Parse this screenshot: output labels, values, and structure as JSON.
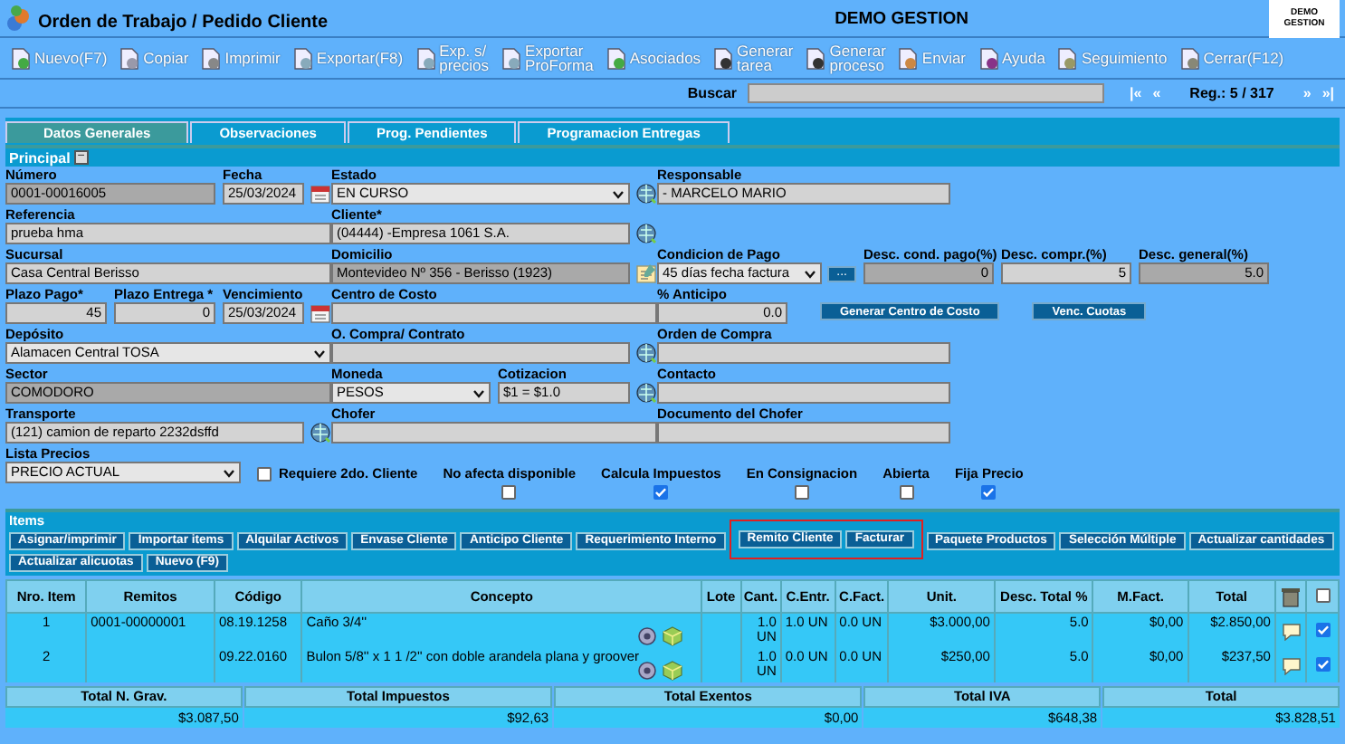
{
  "header": {
    "title": "Orden de Trabajo / Pedido Cliente",
    "company": "DEMO GESTION",
    "logo_text": "DEMO GESTION"
  },
  "toolbar": [
    {
      "label": "Nuevo(F7)"
    },
    {
      "label": "Copiar"
    },
    {
      "label": "Imprimir"
    },
    {
      "label": "Exportar(F8)"
    },
    {
      "label": "Exp. s/\nprecios"
    },
    {
      "label": "Exportar\nProForma"
    },
    {
      "label": "Asociados"
    },
    {
      "label": "Generar\ntarea"
    },
    {
      "label": "Generar\nproceso"
    },
    {
      "label": "Enviar"
    },
    {
      "label": "Ayuda"
    },
    {
      "label": "Seguimiento"
    },
    {
      "label": "Cerrar(F12)"
    }
  ],
  "navigation": {
    "search_label": "Buscar",
    "first": "|«",
    "previous": "«",
    "record": "Reg.: 5 / 317",
    "next": "»",
    "last": "»|"
  },
  "tabs": [
    {
      "label": "Datos Generales",
      "selected": true
    },
    {
      "label": "Observaciones",
      "selected": false
    },
    {
      "label": "Prog. Pendientes",
      "selected": false
    },
    {
      "label": "Programacion Entregas",
      "selected": false
    }
  ],
  "section": {
    "title": "Principal",
    "collapse": "−"
  },
  "form_rows": [
    [
      [
        {
          "label": "Número",
          "value": "0001-00016005",
          "kind": "text",
          "readonly": true,
          "lookup": false,
          "notes": false
        },
        {
          "label": "Fecha",
          "value": "25/03/2024",
          "kind": "date",
          "readonly": false,
          "lookup": false,
          "notes": false
        }
      ],
      [
        {
          "label": "Estado",
          "value": "EN CURSO",
          "kind": "select",
          "readonly": false,
          "lookup": true,
          "notes": false
        }
      ],
      [
        {
          "label": "Responsable",
          "value": "- MARCELO MARIO",
          "kind": "text",
          "readonly": false,
          "lookup": false,
          "notes": false
        }
      ]
    ],
    [
      [
        {
          "label": "Referencia",
          "value": "prueba hma",
          "kind": "text",
          "readonly": false,
          "lookup": false,
          "notes": false
        }
      ],
      [
        {
          "label": "Cliente*",
          "value": "(04444) -Empresa 1061 S.A.",
          "kind": "text",
          "readonly": false,
          "lookup": true,
          "notes": false
        }
      ],
      []
    ],
    [
      [
        {
          "label": "Sucursal",
          "value": "Casa Central Berisso",
          "kind": "text",
          "readonly": false,
          "lookup": false,
          "notes": false
        }
      ],
      [
        {
          "label": "Domicilio",
          "value": "Montevideo Nº 356 - Berisso (1923)",
          "kind": "text",
          "readonly": true,
          "lookup": false,
          "notes": true
        }
      ],
      [
        {
          "label": "Condicion de Pago",
          "value": "45 días fecha factura",
          "kind": "select",
          "readonly": false,
          "lookup": false,
          "notes": false,
          "addon_label": "..."
        },
        {
          "label": "Desc. cond. pago(%)",
          "value": "0",
          "kind": "number",
          "readonly": true,
          "lookup": false,
          "notes": false
        },
        {
          "label": "Desc. compr.(%)",
          "value": "5",
          "kind": "number",
          "readonly": false,
          "lookup": false,
          "notes": false
        },
        {
          "label": "Desc. general(%)",
          "value": "5.0",
          "kind": "number",
          "readonly": true,
          "lookup": false,
          "notes": false
        }
      ]
    ],
    [
      [
        {
          "label": "Plazo Pago*",
          "value": "45",
          "kind": "number",
          "readonly": false,
          "lookup": false,
          "notes": false
        },
        {
          "label": "Plazo Entrega *",
          "value": "0",
          "kind": "number",
          "readonly": false,
          "lookup": false,
          "notes": false
        },
        {
          "label": "Vencimiento",
          "value": "25/03/2024",
          "kind": "date",
          "readonly": false,
          "lookup": false,
          "notes": false
        }
      ],
      [
        {
          "label": "Centro de Costo",
          "kind": "text",
          "readonly": false,
          "lookup": false,
          "notes": false
        }
      ],
      [
        {
          "label": "% Anticipo",
          "value": "0.0",
          "kind": "number",
          "readonly": false,
          "lookup": false,
          "notes": false
        },
        {
          "value": "Generar Centro de Costo",
          "kind": "button"
        },
        {
          "value": "Venc. Cuotas",
          "kind": "button"
        }
      ]
    ],
    [
      [
        {
          "label": "Depósito",
          "value": "Alamacen Central TOSA",
          "kind": "select",
          "readonly": false,
          "lookup": false,
          "notes": false
        }
      ],
      [
        {
          "label": "O. Compra/ Contrato",
          "kind": "text",
          "readonly": false,
          "lookup": true,
          "notes": false
        }
      ],
      [
        {
          "label": "Orden de Compra",
          "kind": "text",
          "readonly": false,
          "lookup": false,
          "notes": false
        }
      ]
    ],
    [
      [
        {
          "label": "Sector",
          "value": "COMODORO",
          "kind": "text",
          "readonly": true,
          "lookup": false,
          "notes": false
        }
      ],
      [
        {
          "label": "Moneda",
          "value": "PESOS",
          "kind": "select",
          "readonly": false,
          "lookup": false,
          "notes": false
        },
        {
          "label": "Cotizacion",
          "value": "$1 = $1.0",
          "kind": "text",
          "readonly": false,
          "lookup": true,
          "notes": false
        }
      ],
      [
        {
          "label": "Contacto",
          "kind": "text",
          "readonly": false,
          "lookup": false,
          "notes": false
        }
      ]
    ],
    [
      [
        {
          "label": "Transporte",
          "value": "(121) camion de reparto 2232dsffd",
          "kind": "text",
          "readonly": false,
          "lookup": true,
          "notes": false
        }
      ],
      [
        {
          "label": "Chofer",
          "kind": "text",
          "readonly": false,
          "lookup": false,
          "notes": false
        }
      ],
      [
        {
          "label": "Documento del Chofer",
          "kind": "text",
          "readonly": false,
          "lookup": false,
          "notes": false
        }
      ]
    ]
  ],
  "price_list": {
    "label": "Lista Precios",
    "value": "PRECIO ACTUAL"
  },
  "options": [
    {
      "label": "Requiere 2do. Cliente",
      "kind": "inline",
      "checked": false
    },
    {
      "label": "No afecta disponible",
      "kind": "stacked",
      "checked": false
    },
    {
      "label": "Calcula Impuestos",
      "kind": "stacked",
      "checked": true
    },
    {
      "label": "En Consignacion",
      "kind": "stacked",
      "checked": false
    },
    {
      "label": "Abierta",
      "kind": "stacked",
      "checked": false
    },
    {
      "label": "Fija Precio",
      "kind": "stacked",
      "checked": true
    }
  ],
  "items": {
    "title": "Items",
    "actions": [
      {
        "label": "Asignar/imprimir",
        "highlighted": false
      },
      {
        "label": "Importar items",
        "highlighted": false
      },
      {
        "label": "Alquilar Activos",
        "highlighted": false
      },
      {
        "label": "Envase Cliente",
        "highlighted": false
      },
      {
        "label": "Anticipo Cliente",
        "highlighted": false
      },
      {
        "label": "Requerimiento Interno",
        "highlighted": false
      },
      {
        "label": "Remito Cliente",
        "highlighted": true
      },
      {
        "label": "Facturar",
        "highlighted": true
      },
      {
        "label": "Paquete Productos",
        "highlighted": false
      },
      {
        "label": "Selección Múltiple",
        "highlighted": false
      },
      {
        "label": "Actualizar cantidades",
        "highlighted": false
      },
      {
        "label": "Actualizar alicuotas",
        "highlighted": false
      },
      {
        "label": "Nuevo (F9)",
        "highlighted": false
      }
    ],
    "columns": [
      {
        "kind": "text",
        "label": "Nro. Item"
      },
      {
        "kind": "text",
        "label": "Remitos"
      },
      {
        "kind": "text",
        "label": "Código"
      },
      {
        "kind": "text",
        "label": "Concepto"
      },
      {
        "kind": "text",
        "label": "Lote"
      },
      {
        "kind": "text",
        "label": "Cant."
      },
      {
        "kind": "text",
        "label": "C.Entr."
      },
      {
        "kind": "text",
        "label": "C.Fact."
      },
      {
        "kind": "text",
        "label": "Unit."
      },
      {
        "kind": "text",
        "label": "Desc. Total %"
      },
      {
        "kind": "text",
        "label": "M.Fact."
      },
      {
        "kind": "text",
        "label": "Total"
      },
      {
        "kind": "icon"
      },
      {
        "kind": "checkbox",
        "checked": false
      }
    ],
    "rows": [
      {
        "item": "1",
        "remitos": "0001-00000001",
        "codigo": "08.19.1258",
        "concepto": "Caño 3/4''",
        "cant": "1.0 UN",
        "entregado": "1.0 UN",
        "facturado": "0.0 UN",
        "unit": "$3.000,00",
        "desc": "5.0",
        "m_fact": "$0,00",
        "total": "$2.850,00",
        "checked": true
      },
      {
        "item": "2",
        "codigo": "09.22.0160",
        "concepto": "Bulon 5/8'' x 1 1 /2'' con doble arandela plana y groover",
        "cant": "1.0 UN",
        "entregado": "0.0 UN",
        "facturado": "0.0 UN",
        "unit": "$250,00",
        "desc": "5.0",
        "m_fact": "$0,00",
        "total": "$237,50",
        "checked": true
      }
    ]
  },
  "totals": [
    {
      "label": "Total N. Grav.",
      "value": "$3.087,50"
    },
    {
      "label": "Total Impuestos",
      "value": "$92,63"
    },
    {
      "label": "Total Exentos",
      "value": "$0,00"
    },
    {
      "label": "Total IVA",
      "value": "$648,38"
    },
    {
      "label": "Total",
      "value": "$3.828,51"
    }
  ]
}
